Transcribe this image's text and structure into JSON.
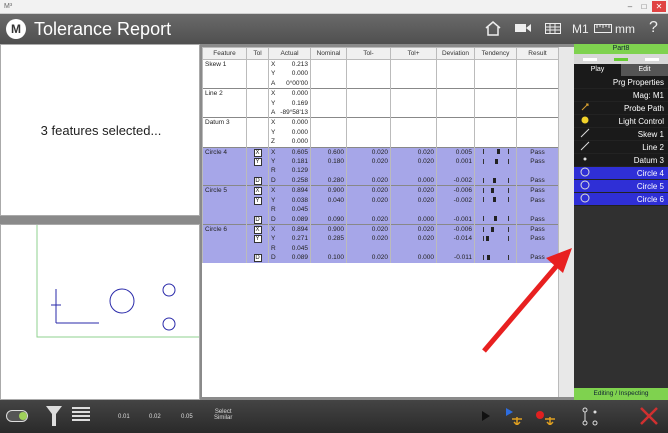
{
  "window": {
    "app_icon": "M³",
    "minimize": "–",
    "maximize": "□",
    "close": "✕"
  },
  "toolbar": {
    "logo": "M",
    "title": "Tolerance Report",
    "home_icon": "house-icon",
    "video_icon": "camera-icon",
    "grid_icon": "table-icon",
    "mode": "M1",
    "ruler_icon": "ruler-icon",
    "units": "mm",
    "help": "?"
  },
  "left": {
    "selection_text": "3 features selected..."
  },
  "table": {
    "headers": [
      "Feature",
      "Tol",
      "Actual",
      "Nominal",
      "Tol-",
      "Tol+",
      "Deviation",
      "Tendency",
      "Result"
    ],
    "groups": [
      {
        "feature": "Skew 1",
        "blue": false,
        "rows": [
          {
            "tol": "",
            "axis": "X",
            "actual": "0.213",
            "nominal": "",
            "tolm": "",
            "tolp": "",
            "dev": "",
            "tend": null,
            "result": ""
          },
          {
            "tol": "",
            "axis": "Y",
            "actual": "0.000",
            "nominal": "",
            "tolm": "",
            "tolp": "",
            "dev": "",
            "tend": null,
            "result": ""
          },
          {
            "tol": "",
            "axis": "A",
            "actual": "0°00'00",
            "nominal": "",
            "tolm": "",
            "tolp": "",
            "dev": "",
            "tend": null,
            "result": ""
          }
        ]
      },
      {
        "feature": "Line 2",
        "blue": false,
        "rows": [
          {
            "tol": "",
            "axis": "X",
            "actual": "0.000",
            "nominal": "",
            "tolm": "",
            "tolp": "",
            "dev": "",
            "tend": null,
            "result": ""
          },
          {
            "tol": "",
            "axis": "Y",
            "actual": "0.169",
            "nominal": "",
            "tolm": "",
            "tolp": "",
            "dev": "",
            "tend": null,
            "result": ""
          },
          {
            "tol": "",
            "axis": "A",
            "actual": "-89°58'13",
            "nominal": "",
            "tolm": "",
            "tolp": "",
            "dev": "",
            "tend": null,
            "result": ""
          }
        ]
      },
      {
        "feature": "Datum 3",
        "blue": false,
        "rows": [
          {
            "tol": "",
            "axis": "X",
            "actual": "0.000",
            "nominal": "",
            "tolm": "",
            "tolp": "",
            "dev": "",
            "tend": null,
            "result": ""
          },
          {
            "tol": "",
            "axis": "Y",
            "actual": "0.000",
            "nominal": "",
            "tolm": "",
            "tolp": "",
            "dev": "",
            "tend": null,
            "result": ""
          },
          {
            "tol": "",
            "axis": "Z",
            "actual": "0.000",
            "nominal": "",
            "tolm": "",
            "tolp": "",
            "dev": "",
            "tend": null,
            "result": ""
          }
        ]
      },
      {
        "feature": "Circle 4",
        "blue": true,
        "rows": [
          {
            "tol": "X",
            "axis": "X",
            "actual": "0.605",
            "nominal": "0.600",
            "tolm": "0.020",
            "tolp": "0.020",
            "dev": "0.005",
            "tend": 0.62,
            "result": "Pass"
          },
          {
            "tol": "Y",
            "axis": "Y",
            "actual": "0.181",
            "nominal": "0.180",
            "tolm": "0.020",
            "tolp": "0.020",
            "dev": "0.001",
            "tend": 0.52,
            "result": "Pass"
          },
          {
            "tol": "",
            "axis": "R",
            "actual": "0.129",
            "nominal": "",
            "tolm": "",
            "tolp": "",
            "dev": "",
            "tend": null,
            "result": ""
          },
          {
            "tol": "D",
            "axis": "D",
            "actual": "0.258",
            "nominal": "0.280",
            "tolm": "0.020",
            "tolp": "0.000",
            "dev": "-0.002",
            "tend": 0.45,
            "result": "Pass"
          }
        ]
      },
      {
        "feature": "Circle 5",
        "blue": true,
        "rows": [
          {
            "tol": "X",
            "axis": "X",
            "actual": "0.894",
            "nominal": "0.900",
            "tolm": "0.020",
            "tolp": "0.020",
            "dev": "-0.006",
            "tend": 0.35,
            "result": "Pass"
          },
          {
            "tol": "Y",
            "axis": "Y",
            "actual": "0.038",
            "nominal": "0.040",
            "tolm": "0.020",
            "tolp": "0.020",
            "dev": "-0.002",
            "tend": 0.45,
            "result": "Pass"
          },
          {
            "tol": "",
            "axis": "R",
            "actual": "0.045",
            "nominal": "",
            "tolm": "",
            "tolp": "",
            "dev": "",
            "tend": null,
            "result": ""
          },
          {
            "tol": "D",
            "axis": "D",
            "actual": "0.089",
            "nominal": "0.090",
            "tolm": "0.020",
            "tolp": "0.000",
            "dev": "-0.001",
            "tend": 0.48,
            "result": "Pass"
          }
        ]
      },
      {
        "feature": "Circle 6",
        "blue": true,
        "rows": [
          {
            "tol": "X",
            "axis": "X",
            "actual": "0.894",
            "nominal": "0.900",
            "tolm": "0.020",
            "tolp": "0.020",
            "dev": "-0.006",
            "tend": 0.35,
            "result": "Pass"
          },
          {
            "tol": "Y",
            "axis": "Y",
            "actual": "0.271",
            "nominal": "0.285",
            "tolm": "0.020",
            "tolp": "0.020",
            "dev": "-0.014",
            "tend": 0.15,
            "result": "Pass"
          },
          {
            "tol": "",
            "axis": "R",
            "actual": "0.045",
            "nominal": "",
            "tolm": "",
            "tolp": "",
            "dev": "",
            "tend": null,
            "result": ""
          },
          {
            "tol": "D",
            "axis": "D",
            "actual": "0.089",
            "nominal": "0.100",
            "tolm": "0.020",
            "tolp": "0.000",
            "dev": "-0.011",
            "tend": 0.2,
            "result": "Pass"
          }
        ]
      }
    ]
  },
  "sidebar": {
    "part": "Part8",
    "tab_play": "Play",
    "tab_edit": "Edit",
    "items": [
      {
        "label": "Prg Properties",
        "icon": "",
        "selected": false
      },
      {
        "label": "Mag: M1",
        "icon": "",
        "selected": false
      },
      {
        "label": "Probe Path",
        "icon": "probe-icon",
        "selected": false
      },
      {
        "label": "Light Control",
        "icon": "bulb-icon",
        "selected": false
      },
      {
        "label": "Skew 1",
        "icon": "line-icon",
        "selected": false
      },
      {
        "label": "Line 2",
        "icon": "line-icon",
        "selected": false
      },
      {
        "label": "Datum 3",
        "icon": "point-icon",
        "selected": false
      },
      {
        "label": "Circle 4",
        "icon": "circle-icon",
        "selected": true
      },
      {
        "label": "Circle 5",
        "icon": "circle-icon",
        "selected": true
      },
      {
        "label": "Circle 6",
        "icon": "circle-icon",
        "selected": true
      }
    ],
    "status": "Editing / Inspecting"
  },
  "bottom": {
    "t1": "0.01",
    "t2": "0.02",
    "t3": "0.05",
    "select_similar_1": "Select",
    "select_similar_2": "Similar",
    "colors": {
      "arrow": "#e82020"
    }
  }
}
